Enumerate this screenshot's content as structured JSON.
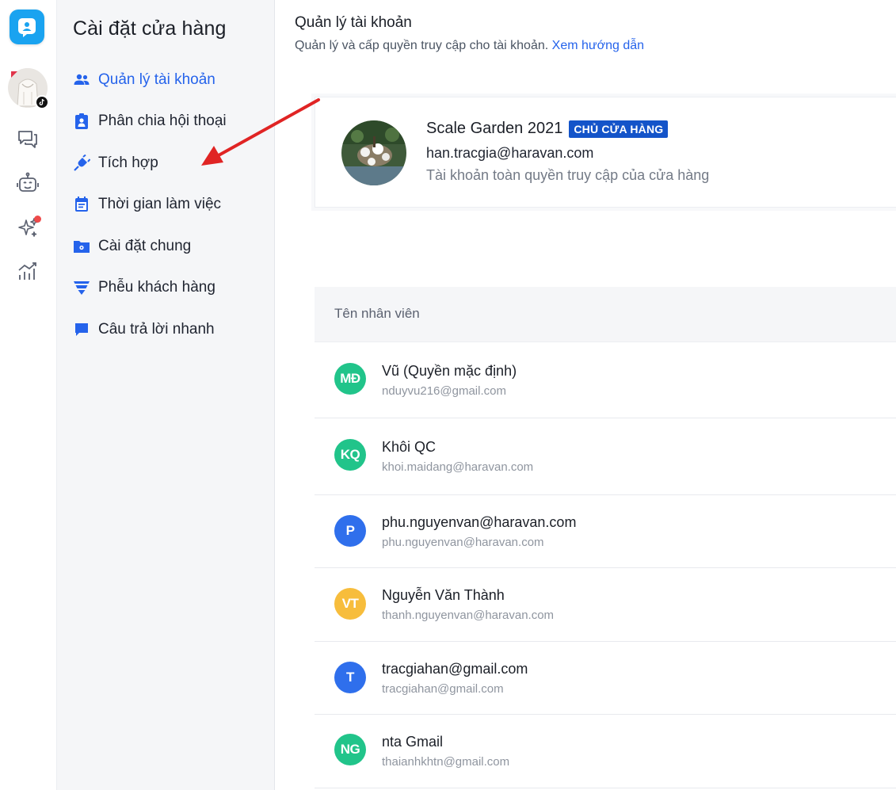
{
  "rail": {
    "items": [
      {
        "name": "chat"
      },
      {
        "name": "bot"
      },
      {
        "name": "ai-sparkle",
        "has_notification": true
      },
      {
        "name": "analytics"
      }
    ]
  },
  "settings": {
    "title": "Cài đặt cửa hàng",
    "items": [
      {
        "label": "Quản lý tài khoản",
        "icon": "users-icon",
        "active": true
      },
      {
        "label": "Phân chia hội thoại",
        "icon": "badge-icon"
      },
      {
        "label": "Tích hợp",
        "icon": "plug-icon"
      },
      {
        "label": "Thời gian làm việc",
        "icon": "calendar-icon"
      },
      {
        "label": "Cài đặt chung",
        "icon": "folder-gear-icon"
      },
      {
        "label": "Phễu khách hàng",
        "icon": "funnel-icon"
      },
      {
        "label": "Câu trả lời nhanh",
        "icon": "message-icon"
      }
    ]
  },
  "main": {
    "title": "Quản lý tài khoản",
    "subtitle": "Quản lý và cấp quyền truy cập cho tài khoản.",
    "guide_link": "Xem hướng dẫn",
    "owner": {
      "name": "Scale Garden 2021",
      "badge": "CHỦ CỬA HÀNG",
      "email": "han.tracgia@haravan.com",
      "description": "Tài khoản toàn quyền truy cập của cửa hàng"
    },
    "table": {
      "header": "Tên nhân viên",
      "rows": [
        {
          "initials": "MĐ",
          "color": "#21c48a",
          "name": "Vũ (Quyền mặc định)",
          "email": "nduyvu216@gmail.com"
        },
        {
          "initials": "KQ",
          "color": "#21c48a",
          "name": "Khôi QC",
          "email": "khoi.maidang@haravan.com"
        },
        {
          "initials": "P",
          "color": "#2f6fec",
          "name": "phu.nguyenvan@haravan.com",
          "email": "phu.nguyenvan@haravan.com"
        },
        {
          "initials": "VT",
          "color": "#f7bd3c",
          "name": "Nguyễn Văn Thành",
          "email": "thanh.nguyenvan@haravan.com"
        },
        {
          "initials": "T",
          "color": "#2f6fec",
          "name": "tracgiahan@gmail.com",
          "email": "tracgiahan@gmail.com"
        },
        {
          "initials": "NG",
          "color": "#21c48a",
          "name": "nta Gmail",
          "email": "thaianhkhtn@gmail.com"
        }
      ]
    }
  },
  "colors": {
    "accent": "#2563eb",
    "badge": "#1454c9",
    "annotation_arrow": "#e02424"
  }
}
